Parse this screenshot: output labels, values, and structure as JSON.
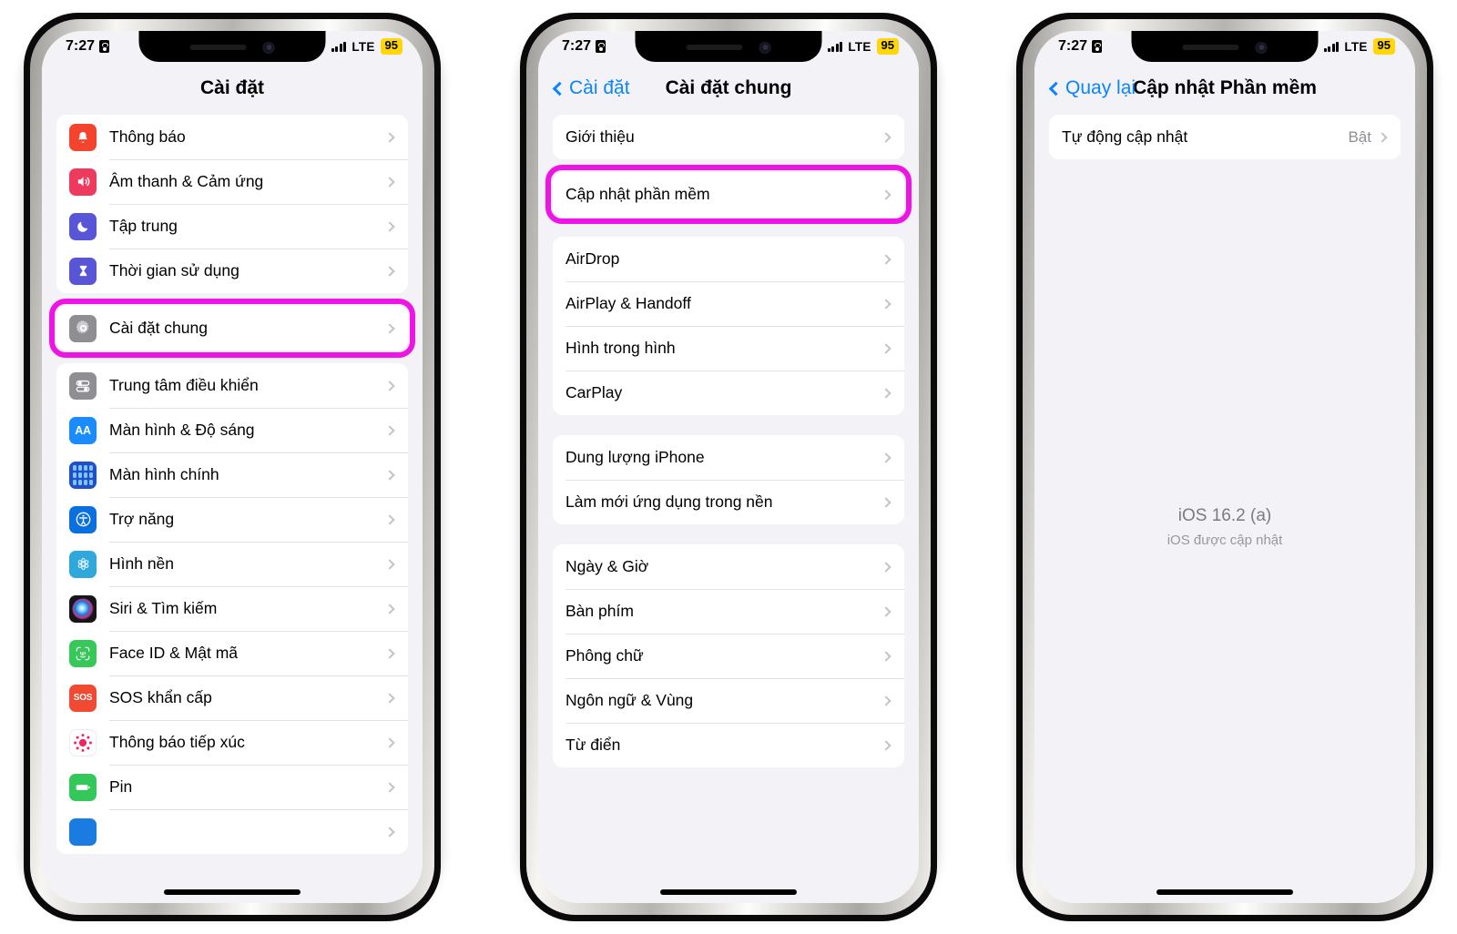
{
  "status_bar": {
    "time": "7:27",
    "lock_icon": "lock-portrait-icon",
    "signal_icon": "cellular-bars-icon",
    "network": "LTE",
    "battery": "95"
  },
  "phones": [
    {
      "id": "phone-settings-root",
      "nav": {
        "back_label": null,
        "title": "Cài đặt"
      },
      "groups": [
        {
          "highlight": false,
          "rows": [
            {
              "label": "Thông báo",
              "icon": "bell-icon",
              "icon_color": "#F4442E",
              "chevron": true
            },
            {
              "label": "Âm thanh & Cảm ứng",
              "icon": "speaker-icon",
              "icon_color": "#EE3A5C",
              "chevron": true
            },
            {
              "label": "Tập trung",
              "icon": "moon-icon",
              "icon_color": "#5855D6",
              "chevron": true
            },
            {
              "label": "Thời gian sử dụng",
              "icon": "hourglass-icon",
              "icon_color": "#5855D6",
              "chevron": true
            }
          ]
        },
        {
          "highlight": true,
          "rows": [
            {
              "label": "Cài đặt chung",
              "icon": "gear-icon",
              "icon_color": "#8E8E93",
              "chevron": true
            }
          ]
        },
        {
          "highlight": false,
          "rows": [
            {
              "label": "Trung tâm điều khiển",
              "icon": "toggles-icon",
              "icon_color": "#8E8E93",
              "chevron": true
            },
            {
              "label": "Màn hình & Độ sáng",
              "icon": "aa-text-icon",
              "icon_color": "#1A8CFF",
              "chevron": true
            },
            {
              "label": "Màn hình chính",
              "icon": "home-grid-icon",
              "icon_color": "#1F4FCB",
              "chevron": true
            },
            {
              "label": "Trợ năng",
              "icon": "accessibility-icon",
              "icon_color": "#0A70E0",
              "chevron": true
            },
            {
              "label": "Hình nền",
              "icon": "wallpaper-flower-icon",
              "icon_color": "#31A8DC",
              "chevron": true
            },
            {
              "label": "Siri & Tìm kiếm",
              "icon": "siri-orb-icon",
              "icon_color": "#16161A",
              "chevron": true
            },
            {
              "label": "Face ID & Mật mã",
              "icon": "face-id-icon",
              "icon_color": "#37C85A",
              "chevron": true
            },
            {
              "label": "SOS khẩn cấp",
              "icon": "sos-icon",
              "icon_color": "#F04A32",
              "chevron": true
            },
            {
              "label": "Thông báo tiếp xúc",
              "icon": "exposure-notification-icon",
              "icon_color": "#FFFFFF",
              "chevron": true
            },
            {
              "label": "Pin",
              "icon": "battery-icon",
              "icon_color": "#34C759",
              "chevron": true
            }
          ]
        }
      ]
    },
    {
      "id": "phone-general-settings",
      "nav": {
        "back_label": "Cài đặt",
        "title": "Cài đặt chung"
      },
      "groups": [
        {
          "highlight": false,
          "rows": [
            {
              "label": "Giới thiệu",
              "icon": null,
              "chevron": true
            }
          ]
        },
        {
          "highlight": true,
          "rows": [
            {
              "label": "Cập nhật phần mềm",
              "icon": null,
              "chevron": true
            }
          ]
        },
        {
          "highlight": false,
          "rows": [
            {
              "label": "AirDrop",
              "icon": null,
              "chevron": true
            },
            {
              "label": "AirPlay & Handoff",
              "icon": null,
              "chevron": true
            },
            {
              "label": "Hình trong hình",
              "icon": null,
              "chevron": true
            },
            {
              "label": "CarPlay",
              "icon": null,
              "chevron": true
            }
          ]
        },
        {
          "highlight": false,
          "rows": [
            {
              "label": "Dung lượng iPhone",
              "icon": null,
              "chevron": true
            },
            {
              "label": "Làm mới ứng dụng trong nền",
              "icon": null,
              "chevron": true
            }
          ]
        },
        {
          "highlight": false,
          "rows": [
            {
              "label": "Ngày & Giờ",
              "icon": null,
              "chevron": true
            },
            {
              "label": "Bàn phím",
              "icon": null,
              "chevron": true
            },
            {
              "label": "Phông chữ",
              "icon": null,
              "chevron": true
            },
            {
              "label": "Ngôn ngữ & Vùng",
              "icon": null,
              "chevron": true
            },
            {
              "label": "Từ điển",
              "icon": null,
              "chevron": true
            }
          ]
        }
      ]
    },
    {
      "id": "phone-software-update",
      "nav": {
        "back_label": "Quay lại",
        "title": "Cập nhật Phần mềm"
      },
      "groups": [
        {
          "highlight": false,
          "rows": [
            {
              "label": "Tự động cập nhật",
              "icon": null,
              "value": "Bật",
              "chevron": true
            }
          ]
        }
      ],
      "version": {
        "title": "iOS 16.2 (a)",
        "subtitle": "iOS được cập nhật"
      }
    }
  ],
  "annotation": {
    "highlight_color": "#ee14e6",
    "accent_link_color": "#0a84ff",
    "battery_badge_color": "#FFD60A"
  }
}
